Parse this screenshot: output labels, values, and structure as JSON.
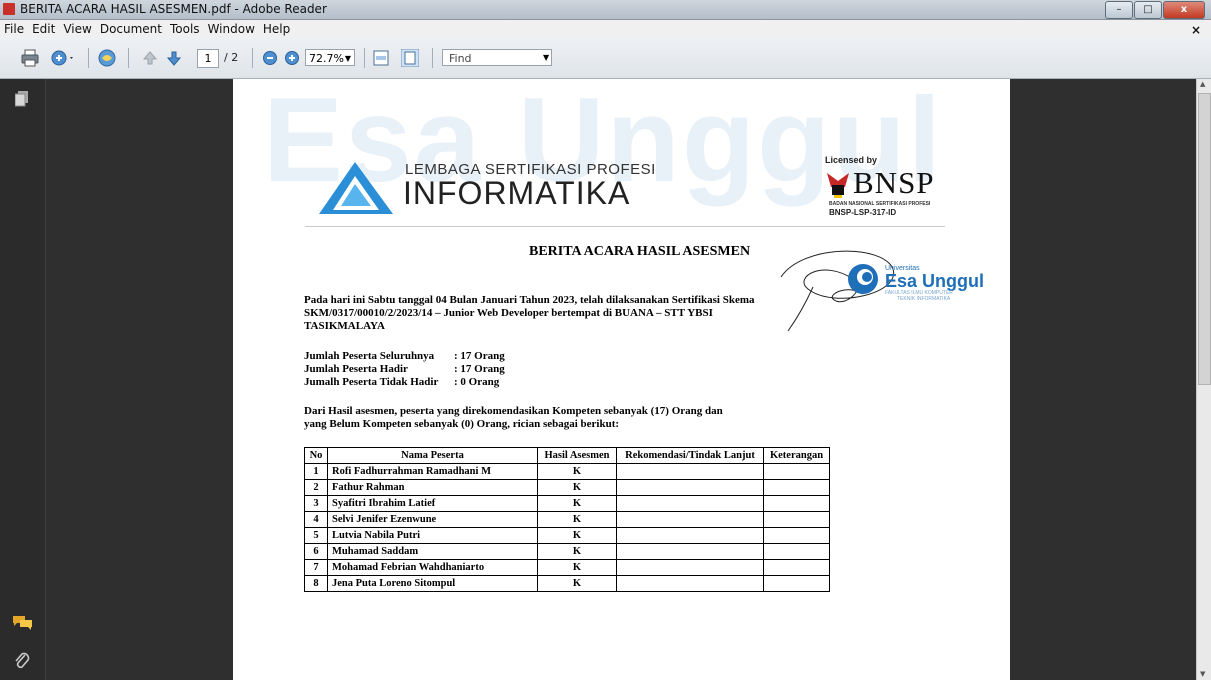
{
  "window": {
    "title": "BERITA ACARA HASIL ASESMEN.pdf - Adobe Reader",
    "minimize": "–",
    "maximize": "□",
    "close": "x"
  },
  "menu": [
    "File",
    "Edit",
    "View",
    "Document",
    "Tools",
    "Window",
    "Help"
  ],
  "menu_close": "×",
  "toolbar": {
    "current_page": "1",
    "total_pages": "/ 2",
    "zoom": "72.7%",
    "find_placeholder": "Find"
  },
  "document": {
    "org_line1": "LEMBAGA SERTIFIKASI PROFESI",
    "org_line2": "INFORMATIKA",
    "licensed_by": "Licensed by",
    "bnsp": "BNSP",
    "bnsp_sub": "BADAN NASIONAL SERTIFIKASI PROFESI",
    "bnsp_id": "BNSP-LSP-317-ID",
    "title": "BERITA ACARA HASIL ASESMEN",
    "uni_small": "Universitas",
    "uni_name": "Esa Unggul",
    "uni_faculty": "FAKULTAS ILMU KOMPUTER",
    "uni_dept": "TEKNIK INFORMATIKA",
    "para1_line1": "Pada hari ini Sabtu tanggal 04 Bulan Januari Tahun 2023, telah dilaksanakan Sertifikasi Skema",
    "para1_line2": "SKM/0317/00010/2/2023/14 – Junior Web Developer bertempat di BUANA – STT YBSI",
    "para1_line3": "TASIKMALAYA",
    "stats": [
      {
        "label": "Jumlah Peserta Seluruhnya",
        "value": ": 17 Orang"
      },
      {
        "label": "Jumlah Peserta Hadir",
        "value": ": 17 Orang"
      },
      {
        "label": "Jumalh Peserta Tidak Hadir",
        "value": ":  0 Orang"
      }
    ],
    "para2_line1": "Dari Hasil asesmen, peserta yang direkomendasikan Kompeten sebanyak (17) Orang dan",
    "para2_line2": "yang Belum Kompeten sebanyak (0) Orang, rician sebagai berikut:",
    "table": {
      "headers": [
        "No",
        "Nama Peserta",
        "Hasil Asesmen",
        "Rekomendasi/Tindak Lanjut",
        "Keterangan"
      ],
      "rows": [
        [
          "1",
          "Rofi Fadhurrahman Ramadhani M",
          "K",
          "",
          ""
        ],
        [
          "2",
          "Fathur Rahman",
          "K",
          "",
          ""
        ],
        [
          "3",
          "Syafitri Ibrahim Latief",
          "K",
          "",
          ""
        ],
        [
          "4",
          "Selvi Jenifer Ezenwune",
          "K",
          "",
          ""
        ],
        [
          "5",
          "Lutvia Nabila Putri",
          "K",
          "",
          ""
        ],
        [
          "6",
          "Muhamad Saddam",
          "K",
          "",
          ""
        ],
        [
          "7",
          "Mohamad Febrian Wahdhaniarto",
          "K",
          "",
          ""
        ],
        [
          "8",
          "Jena Puta Loreno Sitompul",
          "K",
          "",
          ""
        ]
      ]
    }
  },
  "colors": {
    "lsp_blue": "#2a8fd6",
    "bnsp_red": "#c62828",
    "esa_unggul_blue": "#1f6fb8",
    "watermark": "#e8f1f8"
  }
}
